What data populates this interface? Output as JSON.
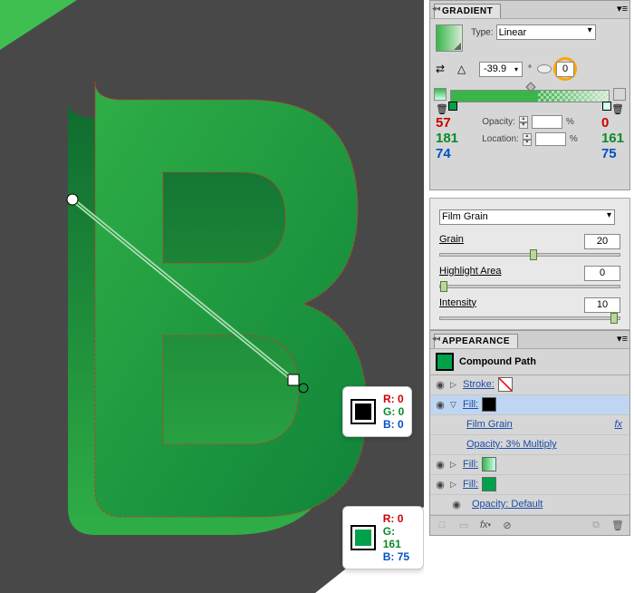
{
  "canvas": {
    "tooltip1": {
      "swatch": "#000000",
      "r": "R: 0",
      "g": "G: 0",
      "b": "B: 0"
    },
    "tooltip2": {
      "swatch": "#00a14b",
      "r": "R: 0",
      "g": "G: 161",
      "b": "B: 75"
    }
  },
  "gradient": {
    "panel_title": "GRADIENT",
    "type_label": "Type:",
    "type_value": "Linear",
    "angle": "-39.9",
    "aspect": "0",
    "opacity_label": "Opacity:",
    "opacity_value": "",
    "opacity_suffix": "%",
    "location_label": "Location:",
    "location_value": "",
    "location_suffix": "%",
    "stop_left": {
      "r": "57",
      "g": "181",
      "b": "74"
    },
    "stop_right": {
      "r": "0",
      "g": "161",
      "b": "75"
    }
  },
  "effect": {
    "name": "Film Grain",
    "grain_label": "Grain",
    "grain_value": "20",
    "highlight_label": "Highlight Area",
    "highlight_value": "0",
    "intensity_label": "Intensity",
    "intensity_value": "10"
  },
  "appearance": {
    "panel_title": "APPEARANCE",
    "object_type": "Compound Path",
    "stroke_label": "Stroke:",
    "fill_label": "Fill:",
    "effect_name": "Film Grain",
    "effect_opacity": "Opacity:  3% Multiply",
    "default_opacity": "Opacity:  Default",
    "footer_fx": "fx"
  }
}
